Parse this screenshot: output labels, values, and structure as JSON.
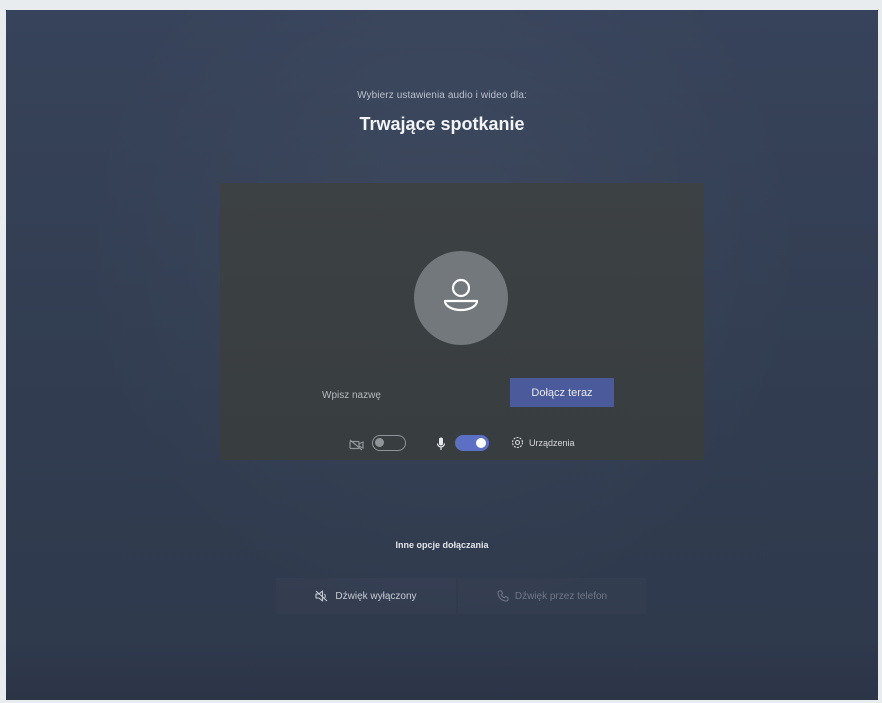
{
  "header": {
    "subtitle": "Wybierz ustawienia audio i wideo dla:",
    "title": "Trwające spotkanie"
  },
  "preview": {
    "avatar_icon": "person-icon",
    "name_placeholder": "Wpisz nazwę",
    "join_label": "Dołącz teraz"
  },
  "controls": {
    "camera_icon": "camera-off-icon",
    "camera_toggle": "off",
    "mic_icon": "microphone-icon",
    "mic_toggle": "on",
    "devices_icon": "gear-icon",
    "devices_label": "Urządzenia"
  },
  "other_options": {
    "heading": "Inne opcje dołączania",
    "audio_off_label": "Dźwięk wyłączony",
    "audio_off_icon": "speaker-off-icon",
    "phone_label": "Dźwięk przez telefon",
    "phone_icon": "phone-icon"
  },
  "colors": {
    "background": "#343f52",
    "preview": "#3a3f41",
    "accent": "#5b6fc4",
    "join_button": "#4a5a9a"
  }
}
